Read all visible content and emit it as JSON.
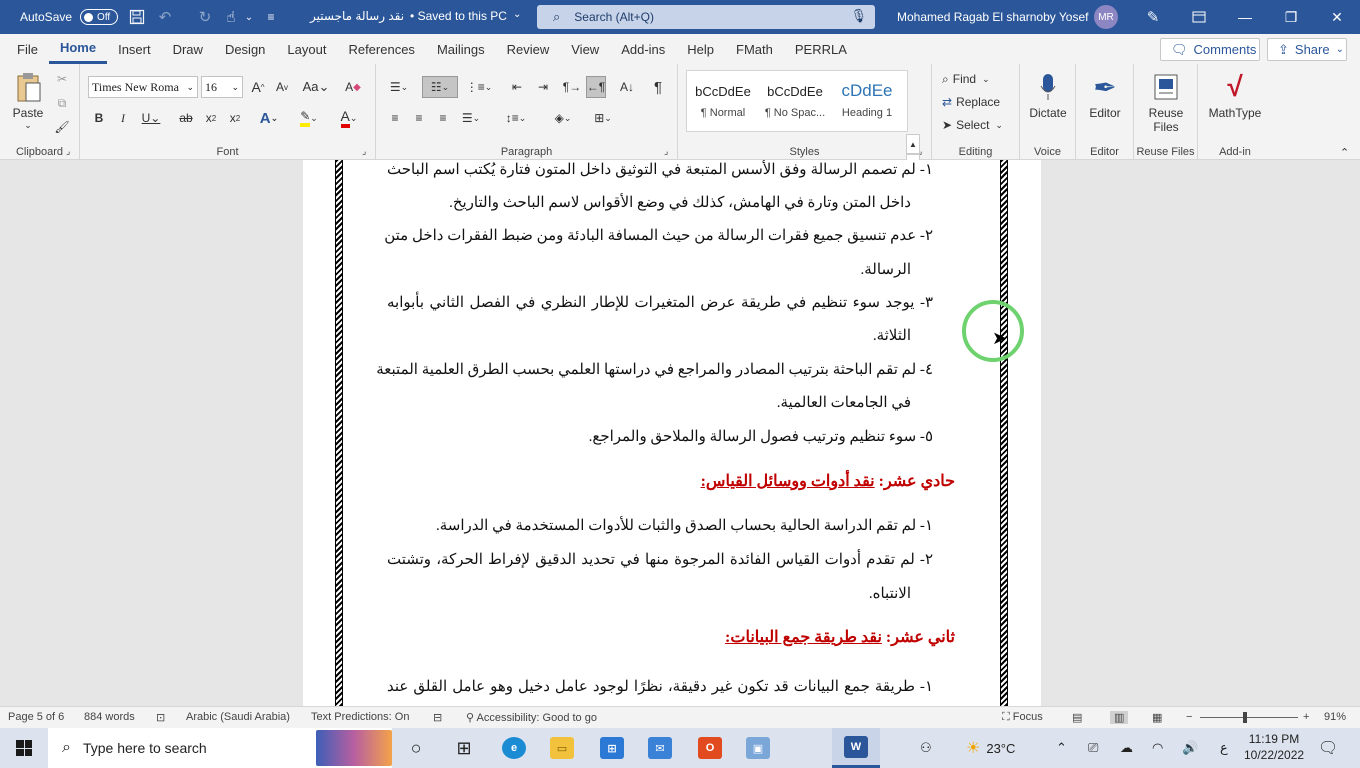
{
  "titlebar": {
    "autosave_label": "AutoSave",
    "autosave_state": "Off",
    "doc_title": "نقد رسالة ماجستير",
    "save_status": "• Saved to this PC",
    "search_placeholder": "Search (Alt+Q)",
    "user_name": "Mohamed Ragab El sharnoby Yosef",
    "user_initials": "MR"
  },
  "tabs": [
    "File",
    "Home",
    "Insert",
    "Draw",
    "Design",
    "Layout",
    "References",
    "Mailings",
    "Review",
    "View",
    "Add-ins",
    "Help",
    "FMath",
    "PERRLA"
  ],
  "active_tab": "Home",
  "tab_actions": {
    "comments": "Comments",
    "share": "Share"
  },
  "ribbon": {
    "clipboard": {
      "label": "Clipboard",
      "paste": "Paste"
    },
    "font": {
      "label": "Font",
      "name": "Times New Roma",
      "size": "16"
    },
    "paragraph": {
      "label": "Paragraph"
    },
    "styles": {
      "label": "Styles",
      "items": [
        {
          "preview": "bCcDdEe",
          "name": "¶ Normal"
        },
        {
          "preview": "bCcDdEe",
          "name": "¶ No Spac..."
        },
        {
          "preview": "cDdEe",
          "name": "Heading 1"
        }
      ]
    },
    "editing": {
      "label": "Editing",
      "find": "Find",
      "replace": "Replace",
      "select": "Select"
    },
    "voice": {
      "label": "Voice",
      "dictate": "Dictate"
    },
    "editor": {
      "label": "Editor",
      "editor": "Editor"
    },
    "reuse": {
      "label": "Reuse Files",
      "button_line1": "Reuse",
      "button_line2": "Files"
    },
    "addin": {
      "label": "Add-in",
      "mathtype": "MathType"
    }
  },
  "document": {
    "lines": [
      "١- لم تصمم الرسالة وفق الأسس المتبعة في التوثيق داخل المتون فتارة يُكتب اسم الباحث",
      "داخل المتن وتارة في الهامش، كذلك في وضع الأقواس لاسم الباحث والتاريخ.",
      "٢- عدم تنسيق جميع فقرات الرسالة من حيث المسافة البادئة ومن ضبط الفقرات داخل متن",
      "الرسالة.",
      "٣- يوجد سوء تنظيم في طريقة عرض المتغيرات للإطار النظري في الفصل الثاني بأبوابه",
      "الثلاثة.",
      "٤- لم تقم الباحثة بترتيب المصادر والمراجع في دراستها العلمي بحسب الطرق العلمية المتبعة",
      "في الجامعات العالمية.",
      "٥- سوء تنظيم وترتيب فصول الرسالة والملاحق والمراجع."
    ],
    "heading1_prefix": "حادي عشر: ",
    "heading1_title": "نقد أدوات ووسائل القياس:",
    "lines2": [
      "١- لم تقم الدراسة الحالية بحساب الصدق والثبات للأدوات المستخدمة في الدراسة.",
      "٢- لم تقدم أدوات القياس الفائدة المرجوة منها في تحديد الدقيق لإفراط الحركة، وتشتت",
      "الانتباه."
    ],
    "heading2_prefix": "ثاني عشر: ",
    "heading2_title": "نقد طريقة جمع البيانات:",
    "lines3": [
      "١- طريقة جمع البيانات قد تكون غير دقيقة، نظرًا لوجود عامل دخيل وهو عامل القلق عند"
    ]
  },
  "statusbar": {
    "page": "Page 5 of 6",
    "words": "884 words",
    "language": "Arabic (Saudi Arabia)",
    "predictions": "Text Predictions: On",
    "accessibility": "Accessibility: Good to go",
    "focus": "Focus",
    "zoom": "91%"
  },
  "taskbar": {
    "search_placeholder": "Type here to search",
    "weather": "23°C",
    "input_lang": "ع",
    "time": "11:19 PM",
    "date": "10/22/2022"
  }
}
